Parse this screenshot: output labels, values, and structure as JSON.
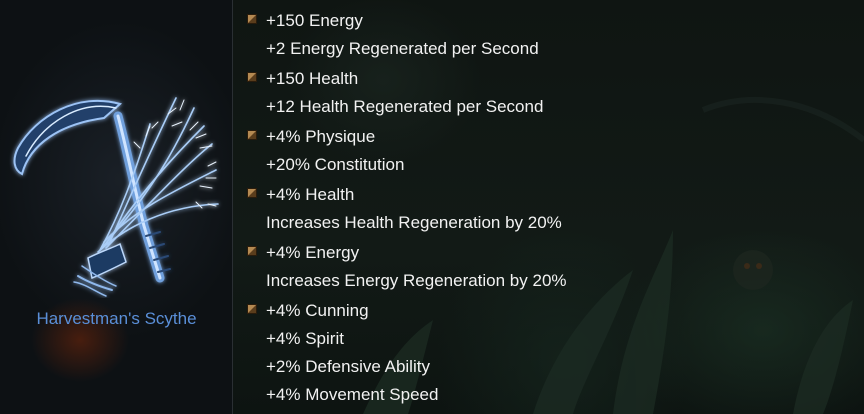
{
  "item": {
    "name": "Harvestman's Scythe",
    "icon": "scythe-icon"
  },
  "bullet_icon": "bronze-bullet-icon",
  "colors": {
    "item_name": "#5a8fd8",
    "text": "#f2f2f2",
    "bullet": "#b58a52"
  },
  "bonuses": [
    {
      "lines": [
        "+150 Energy",
        "+2 Energy Regenerated per Second"
      ]
    },
    {
      "lines": [
        "+150 Health",
        "+12 Health Regenerated per Second"
      ]
    },
    {
      "lines": [
        "+4% Physique",
        "+20% Constitution"
      ]
    },
    {
      "lines": [
        "+4% Health",
        "Increases Health Regeneration by 20%"
      ]
    },
    {
      "lines": [
        "+4% Energy",
        "Increases Energy Regeneration by 20%"
      ]
    },
    {
      "lines": [
        "+4% Cunning",
        "+4% Spirit",
        "+2% Defensive Ability",
        "+4% Movement Speed"
      ]
    }
  ]
}
